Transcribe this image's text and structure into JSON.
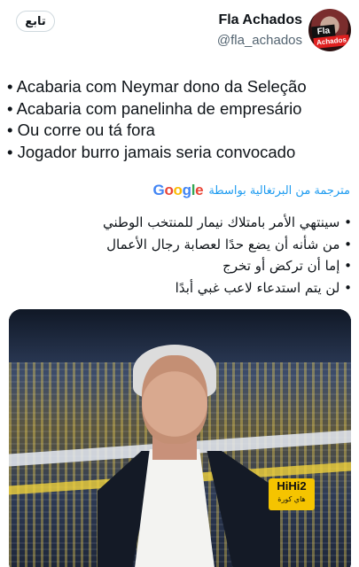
{
  "header": {
    "follow_label": "تابع",
    "display_name": "Fla Achados",
    "handle": "@fla_achados",
    "avatar_text_top": "Fla",
    "avatar_text_bottom": "Achados"
  },
  "tweet": {
    "lines": [
      "• Acabaria com Neymar dono da Seleção",
      "• Acabaria com panelinha de empresário",
      "• Ou corre ou tá fora",
      "• Jogador burro jamais seria convocado"
    ]
  },
  "translation": {
    "label": "مترجمة من البرتغالية بواسطة",
    "provider": "Google",
    "lines": [
      "• سينتهي الأمر بامتلاك نيمار للمنتخب الوطني",
      "• من شأنه أن يضع حدًا لعصابة رجال الأعمال",
      "• إما أن تركض أو تخرج",
      "• لن يتم استدعاء لاعب غبي أبدًا"
    ]
  },
  "media": {
    "watermark_top": "HiHi2",
    "watermark_bottom": "هاي كورة"
  },
  "colors": {
    "link_blue": "#1d9bf0",
    "text_primary": "#0f1419",
    "text_secondary": "#536471"
  }
}
